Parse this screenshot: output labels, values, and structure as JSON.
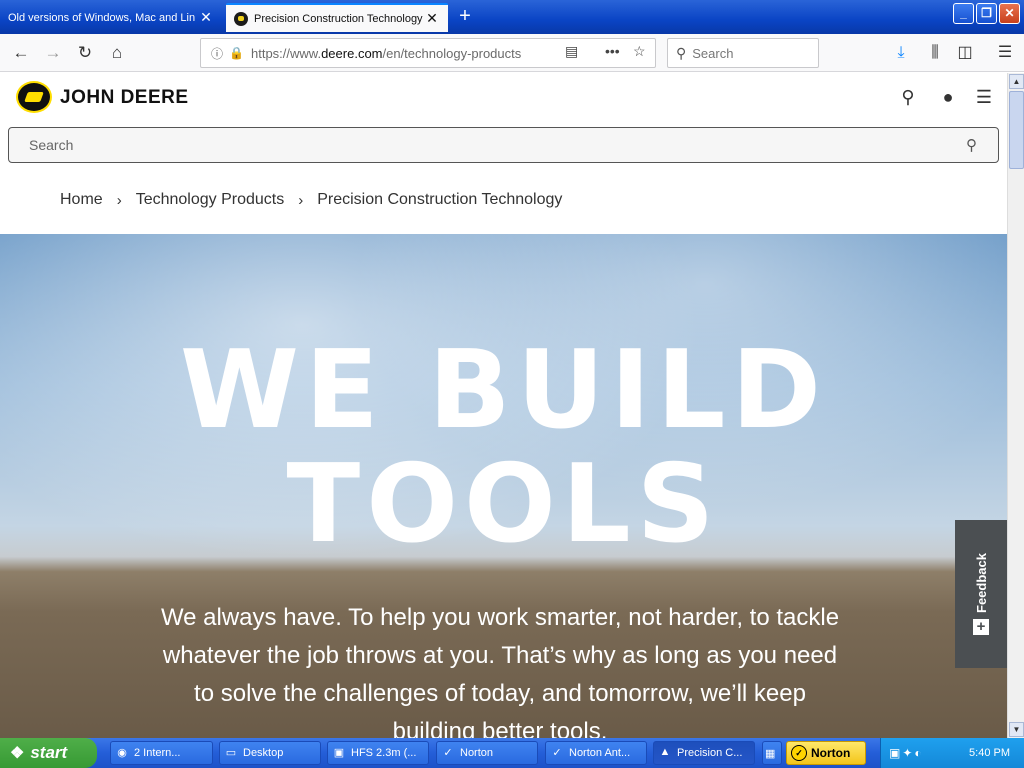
{
  "browser": {
    "tabs": [
      {
        "label": "Old versions of Windows, Mac and Lin"
      },
      {
        "label": "Precision Construction Technology"
      }
    ],
    "new_tab_icon": "plus-icon",
    "url_prefix": "https://www.",
    "url_domain": "deere.com",
    "url_suffix": "/en/technology-products",
    "search_placeholder": "Search"
  },
  "site": {
    "logo_text": "JOHN DEERE",
    "search_placeholder": "Search",
    "breadcrumb": [
      "Home",
      "Technology Products",
      "Precision Construction Technology"
    ],
    "hero_title_line1": "WE BUILD",
    "hero_title_line2": "TOOLS",
    "hero_text": "We always have. To help you work smarter, not harder, to tackle whatever the job throws at you. That’s why as long as you need to solve the challenges of today, and tomorrow, we’ll keep building better tools.",
    "feedback_label": "Feedback",
    "feedback_icon": "plus-icon"
  },
  "taskbar": {
    "start_label": "start",
    "tasks": [
      "2 Intern...",
      "Desktop",
      "HFS 2.3m (...",
      "Norton",
      "Norton Ant...",
      "Precision C..."
    ],
    "norton_label": "Norton",
    "clock": "5:40 PM"
  }
}
